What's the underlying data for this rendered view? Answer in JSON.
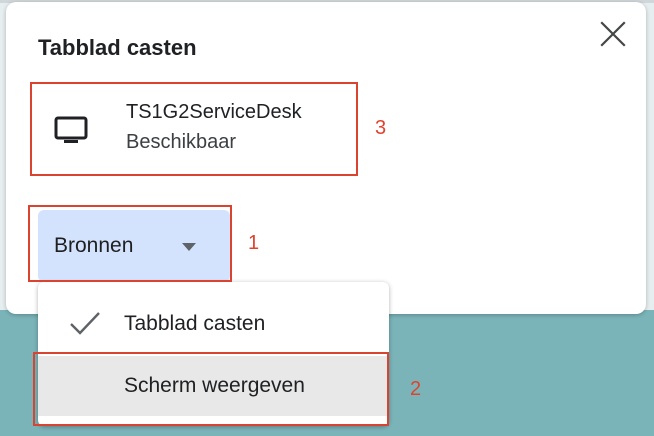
{
  "dialog": {
    "title": "Tabblad casten",
    "close_icon": "close-icon"
  },
  "sink": {
    "icon": "monitor-icon",
    "name": "TS1G2ServiceDesk",
    "status": "Beschikbaar"
  },
  "sources": {
    "label": "Bronnen",
    "icon": "caret-down-icon"
  },
  "menu": {
    "items": [
      {
        "label": "Tabblad casten",
        "checked": true,
        "icon": "checkmark-icon"
      },
      {
        "label": "Scherm weergeven",
        "checked": false,
        "hovered": true
      }
    ]
  },
  "annotations": [
    {
      "number": "1",
      "target": "sources-button"
    },
    {
      "number": "2",
      "target": "menu-item-scherm-weergeven"
    },
    {
      "number": "3",
      "target": "sink-item"
    }
  ],
  "colors": {
    "annotation": "#d9432f",
    "sources_button_bg": "#d3e3fd",
    "hover_bg": "#e8e8e8",
    "backdrop": "#7ab4b9"
  }
}
